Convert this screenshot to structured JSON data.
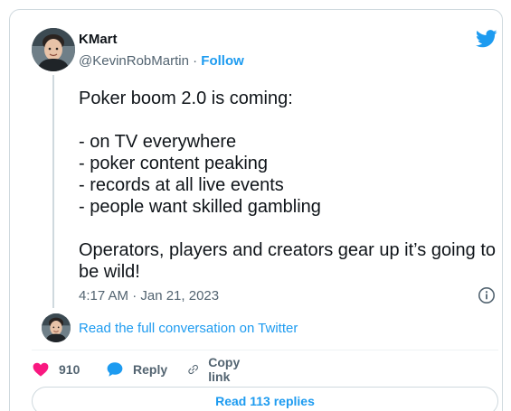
{
  "author": {
    "name": "KMart",
    "handle": "@KevinRobMartin",
    "separator": "·",
    "follow_label": "Follow"
  },
  "tweet": {
    "lines": [
      "Poker boom 2.0 is coming:",
      "",
      "- on TV everywhere",
      "- poker content peaking",
      "- records at all live events",
      "- people want skilled gambling",
      "",
      "Operators, players and creators gear up it’s going to",
      "be wild!"
    ],
    "timestamp": "4:17 AM · Jan 21, 2023"
  },
  "conversation": {
    "read_full_label": "Read the full conversation on Twitter"
  },
  "actions": {
    "like_count": "910",
    "reply_label": "Reply",
    "copy_label": "Copy link"
  },
  "replies_button": {
    "label": "Read 113 replies"
  },
  "colors": {
    "accent": "#1d9bf0",
    "like": "#f91880",
    "text": "#0f1419",
    "muted": "#536471",
    "border": "#cfd9de"
  },
  "icons": {
    "brand": "twitter-bird-icon",
    "info": "info-icon",
    "like": "heart-icon",
    "reply": "speech-bubble-icon",
    "copy": "link-icon"
  }
}
